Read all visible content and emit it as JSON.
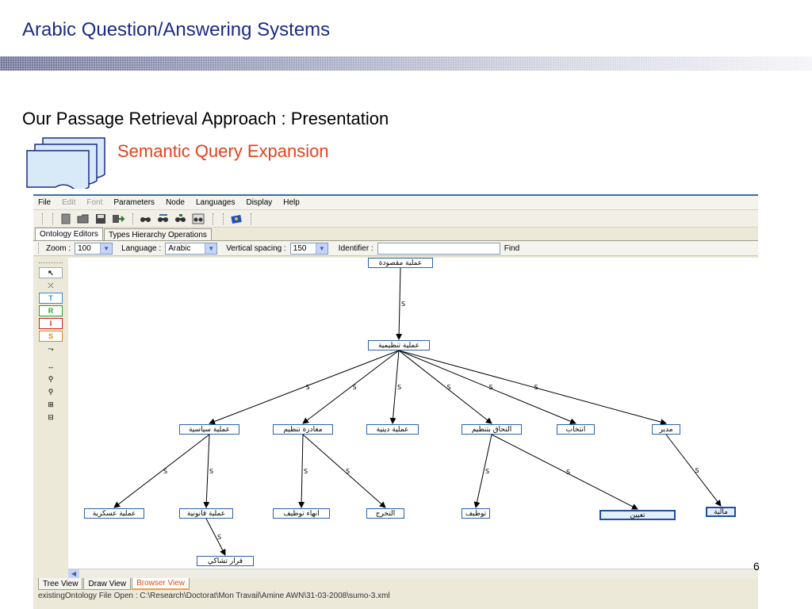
{
  "slide": {
    "title": "Arabic Question/Answering Systems",
    "subtitle": "Our Passage Retrieval Approach : Presentation",
    "section": "Semantic Query Expansion",
    "page_number": "6"
  },
  "menu": [
    "File",
    "Edit",
    "Font",
    "Parameters",
    "Node",
    "Languages",
    "Display",
    "Help"
  ],
  "top_tabs": [
    "Ontology Editors",
    "Types Hierarchy Operations"
  ],
  "options": {
    "zoom_label": "Zoom :",
    "zoom_value": "100",
    "language_label": "Language :",
    "language_value": "Arabic",
    "vspacing_label": "Vertical spacing :",
    "vspacing_value": "150",
    "identifier_label": "Identifier :",
    "identifier_value": "",
    "find_label": "Find"
  },
  "palette": [
    "T",
    "R",
    "I",
    "S"
  ],
  "graph": {
    "edge_label": "S",
    "nodes": {
      "root": "عملية مقصودة",
      "n1": "عملية تنظيمية",
      "c1": "عملية سياسية",
      "c2": "مغادرة تنظيم",
      "c3": "عملية دينية",
      "c4": "التحاق بتنظيم",
      "c5": "انتخاب",
      "c6": "مدير",
      "g1": "عملية عسكرية",
      "g2": "عملية قانونية",
      "g3": "انهاء توظيف",
      "g4": "التخرج",
      "g5": "توظيف",
      "g6": "تعيين",
      "g7": "مالية",
      "h1": "قرار تشاكي"
    }
  },
  "bottom_tabs": [
    "Tree View",
    "Draw View",
    "Browser View"
  ],
  "status": "existingOntology File Open : C:\\Research\\Doctorat\\Mon Travail\\Amine AWN\\31-03-2008\\sumo-3.xml"
}
